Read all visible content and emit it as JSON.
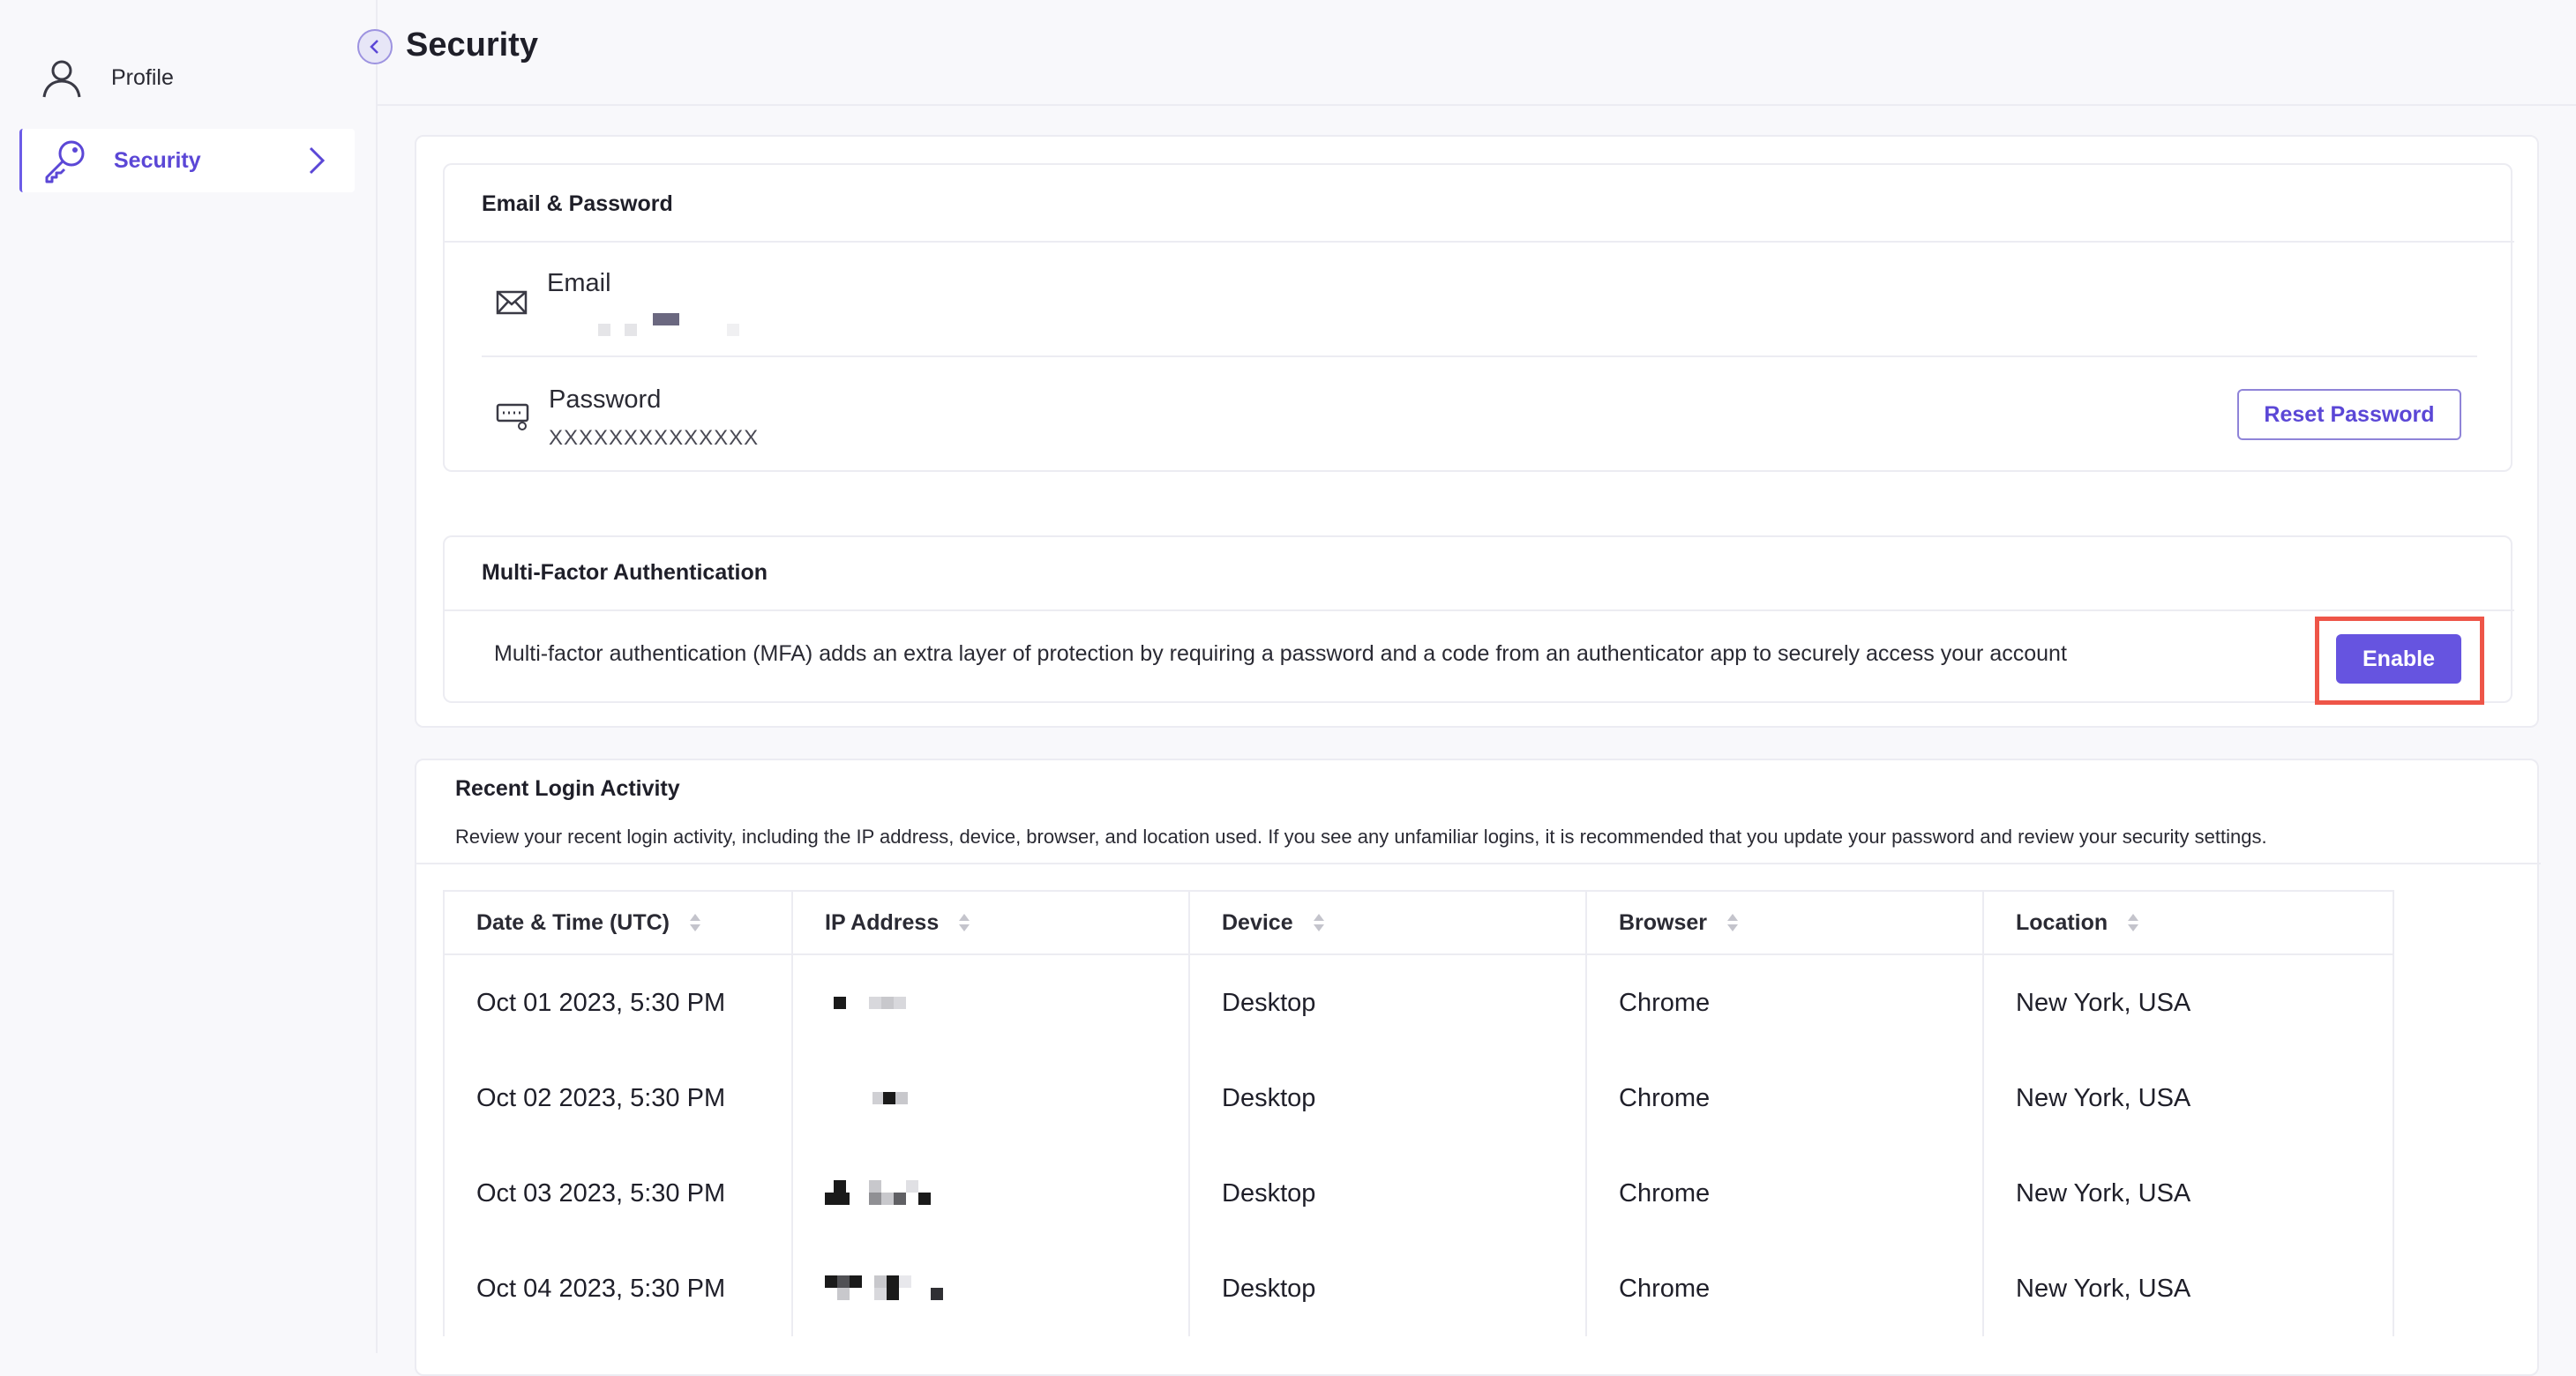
{
  "sidebar": {
    "items": [
      {
        "label": "Profile",
        "icon": "user-icon"
      },
      {
        "label": "Security",
        "icon": "key-icon"
      }
    ]
  },
  "header": {
    "title": "Security"
  },
  "email_password": {
    "title": "Email & Password",
    "email_label": "Email",
    "password_label": "Password",
    "password_value": "XXXXXXXXXXXXXX",
    "reset_label": "Reset Password"
  },
  "mfa": {
    "title": "Multi-Factor Authentication",
    "description": "Multi-factor authentication (MFA) adds an extra layer of protection by requiring a password and a code from an authenticator app to securely access your account",
    "enable_label": "Enable"
  },
  "activity": {
    "title": "Recent Login Activity",
    "description": "Review your recent login activity, including the IP address, device, browser, and location used. If you see any unfamiliar logins, it is recommended that you update your password and review your security settings.",
    "columns": [
      "Date & Time (UTC)",
      "IP Address",
      "Device",
      "Browser",
      "Location"
    ],
    "rows": [
      {
        "datetime": "Oct 01 2023, 5:30 PM",
        "device": "Desktop",
        "browser": "Chrome",
        "location": "New York, USA"
      },
      {
        "datetime": "Oct 02 2023, 5:30 PM",
        "device": "Desktop",
        "browser": "Chrome",
        "location": "New York, USA"
      },
      {
        "datetime": "Oct 03 2023, 5:30 PM",
        "device": "Desktop",
        "browser": "Chrome",
        "location": "New York, USA"
      },
      {
        "datetime": "Oct 04 2023, 5:30 PM",
        "device": "Desktop",
        "browser": "Chrome",
        "location": "New York, USA"
      }
    ]
  },
  "colors": {
    "accent": "#6654e0",
    "highlight": "#ee5548"
  }
}
